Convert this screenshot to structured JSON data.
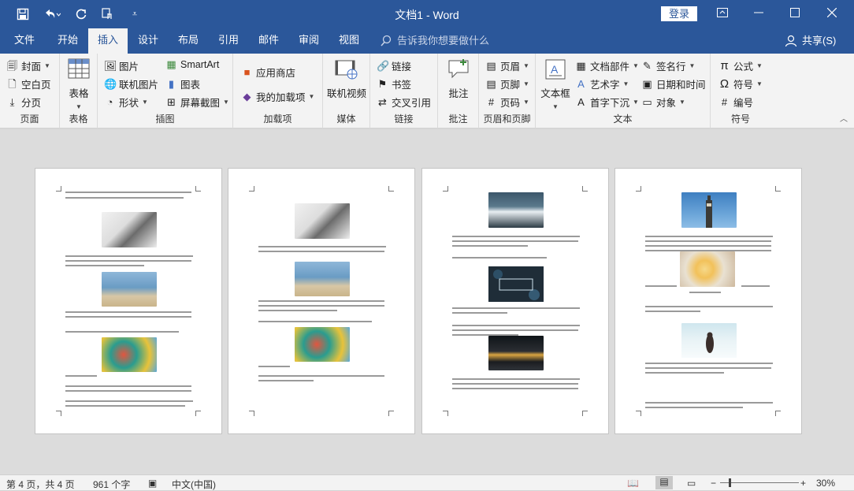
{
  "title": {
    "doc": "文档1",
    "sep": "-",
    "app": "Word",
    "full": "文档1  -  Word",
    "login": "登录"
  },
  "qat": {
    "save": "save-icon",
    "undo": "undo-icon",
    "redo": "redo-icon",
    "touch": "touch-mode-icon",
    "customize": "customize-icon"
  },
  "tabs": [
    "文件",
    "开始",
    "插入",
    "设计",
    "布局",
    "引用",
    "邮件",
    "审阅",
    "视图"
  ],
  "tellme": "告诉我你想要做什么",
  "share": "共享(S)",
  "ribbon": {
    "pages": {
      "label": "页面",
      "items": [
        "封面",
        "空白页",
        "分页"
      ]
    },
    "tables": {
      "label": "表格",
      "button": "表格"
    },
    "illustrations": {
      "label": "插图",
      "items": [
        "图片",
        "联机图片",
        "形状",
        "SmartArt",
        "图表",
        "屏幕截图"
      ]
    },
    "addins": {
      "label": "加载项",
      "items": [
        "应用商店",
        "我的加载项"
      ]
    },
    "media": {
      "label": "媒体",
      "button": "联机视频"
    },
    "links": {
      "label": "链接",
      "items": [
        "链接",
        "书签",
        "交叉引用"
      ]
    },
    "comments": {
      "label": "批注",
      "button": "批注"
    },
    "headerfooter": {
      "label": "页眉和页脚",
      "items": [
        "页眉",
        "页脚",
        "页码"
      ]
    },
    "text": {
      "label": "文本",
      "textbox": "文本框",
      "items": [
        "文档部件",
        "艺术字",
        "首字下沉",
        "签名行",
        "日期和时间",
        "对象"
      ]
    },
    "symbols": {
      "label": "符号",
      "items": [
        "公式",
        "符号",
        "编号"
      ]
    }
  },
  "status": {
    "page": "第 4 页，共 4 页",
    "words": "961 个字",
    "lang": "中文(中国)",
    "zoom": "30%"
  },
  "colors": {
    "brand": "#2b579a",
    "ribbon": "#f3f3f3",
    "canvas": "#dcdcdc"
  }
}
